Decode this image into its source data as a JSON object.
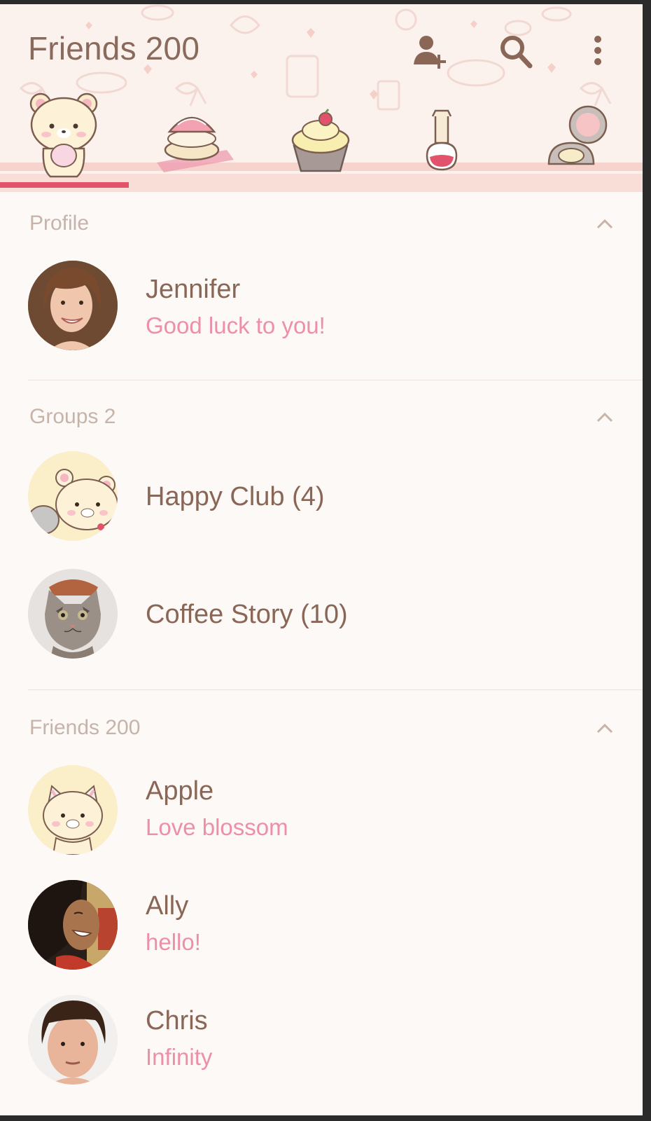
{
  "header": {
    "title": "Friends 200",
    "actions": [
      {
        "icon": "add-friend-icon"
      },
      {
        "icon": "search-icon"
      },
      {
        "icon": "more-vertical-icon"
      }
    ],
    "tabs": [
      {
        "icon": "bear-tab-icon",
        "selected": true
      },
      {
        "icon": "cream-puff-tab-icon",
        "selected": false
      },
      {
        "icon": "cupcake-tab-icon",
        "selected": false
      },
      {
        "icon": "nail-polish-tab-icon",
        "selected": false
      },
      {
        "icon": "compact-mirror-tab-icon",
        "selected": false
      }
    ]
  },
  "profile": {
    "header": "Profile",
    "user": {
      "name": "Jennifer",
      "status": "Good luck to you!"
    }
  },
  "groups": {
    "header": "Groups 2",
    "items": [
      {
        "name": "Happy Club (4)"
      },
      {
        "name": "Coffee Story (10)"
      }
    ]
  },
  "friends": {
    "header": "Friends 200",
    "items": [
      {
        "name": "Apple",
        "status": "Love blossom"
      },
      {
        "name": "Ally",
        "status": "hello!"
      },
      {
        "name": "Chris",
        "status": "Infinity"
      }
    ]
  },
  "colors": {
    "background": "#fdf9f6",
    "header_bg": "#fbf2ee",
    "title_text": "#8a6a5c",
    "name_text": "#8a6656",
    "status_text": "#ee8fa8",
    "section_text": "#c6b4ab",
    "tab_indicator": "#e2536b"
  }
}
